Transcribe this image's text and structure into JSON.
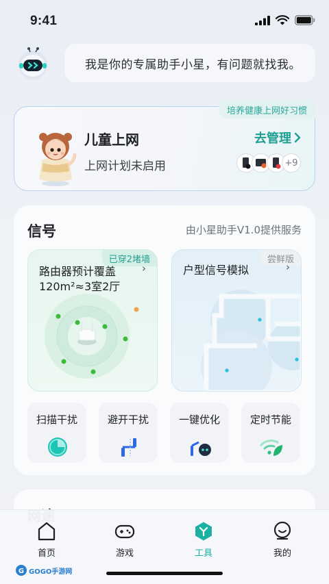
{
  "status_bar": {
    "time": "9:41"
  },
  "assistant": {
    "message": "我是你的专属助手小星，有问题就找我。"
  },
  "child_internet": {
    "tag": "培养健康上网好习惯",
    "title": "儿童上网",
    "status": "上网计划未启用",
    "manage_label": "去管理",
    "more_devices": "+9"
  },
  "signal": {
    "title": "信号",
    "provider": "由小星助手V1.0提供服务",
    "coverage_card": {
      "tag": "已穿2堵墙",
      "label": "路由器预计覆盖",
      "value": "120m²≈3室2厅"
    },
    "floorplan_card": {
      "tag": "尝鲜版",
      "label": "户型信号模拟"
    }
  },
  "tools": [
    {
      "label": "扫描干扰",
      "icon": "scan-icon"
    },
    {
      "label": "避开干扰",
      "icon": "avoid-interference-icon"
    },
    {
      "label": "一键优化",
      "icon": "optimize-icon"
    },
    {
      "label": "定时节能",
      "icon": "wifi-leaf-icon"
    }
  ],
  "next_section": {
    "title": "网速"
  },
  "tabbar": {
    "items": [
      {
        "label": "首页",
        "icon": "home-icon"
      },
      {
        "label": "游戏",
        "icon": "gamepad-icon"
      },
      {
        "label": "工具",
        "icon": "tools-icon",
        "active": true
      },
      {
        "label": "我的",
        "icon": "profile-icon"
      }
    ]
  },
  "watermark": {
    "text": "GOGO手游网"
  },
  "colors": {
    "accent": "#1bb0a2",
    "link": "#1e9f94",
    "tag_text": "#2ba79b"
  }
}
